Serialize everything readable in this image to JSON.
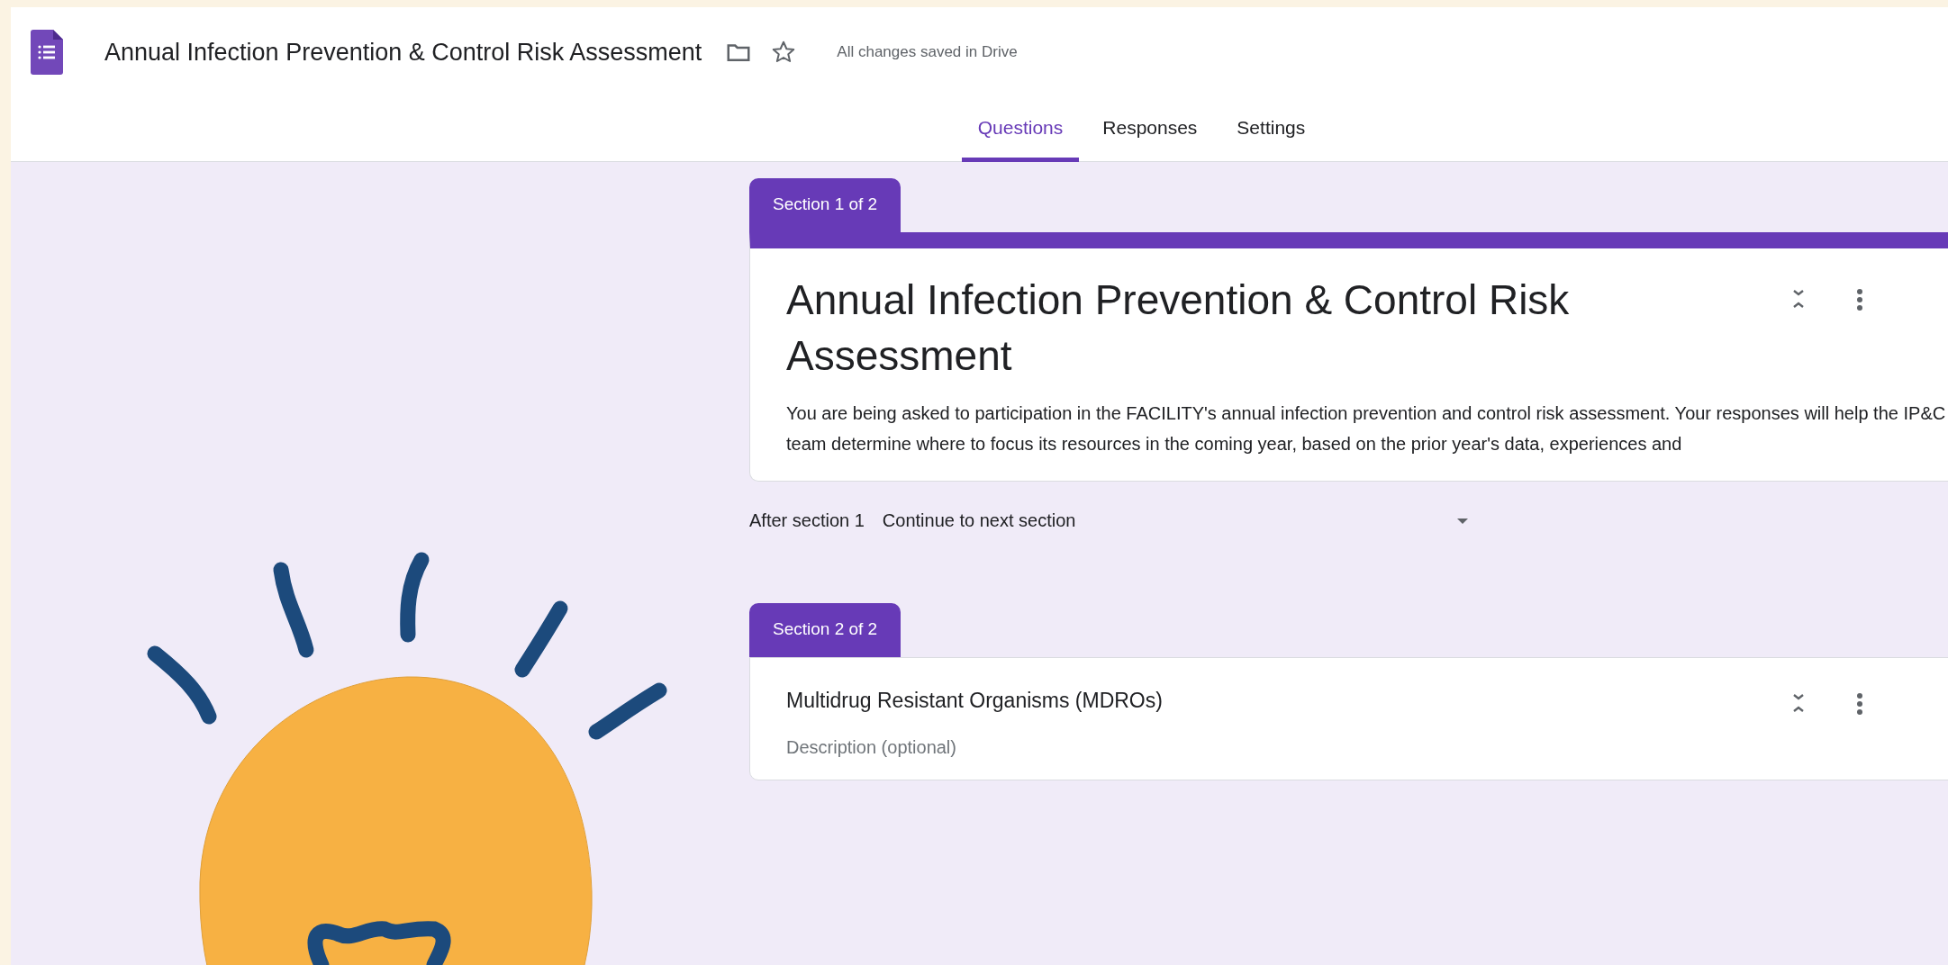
{
  "header": {
    "title": "Annual Infection Prevention & Control Risk Assessment",
    "status": "All changes saved in Drive",
    "starred": false
  },
  "tabs": [
    {
      "label": "Questions",
      "selected": true
    },
    {
      "label": "Responses",
      "selected": false
    },
    {
      "label": "Settings",
      "selected": false
    }
  ],
  "sections": [
    {
      "kind": "header",
      "tab_label": "Section 1 of 2",
      "title": "Annual Infection Prevention & Control Risk Assessment",
      "description": "You are being asked to participation in the FACILITY's annual infection prevention and control risk assessment. Your responses will help the IP&C team determine where to focus its resources in the coming year, based on the prior year's data, experiences and",
      "after": {
        "label": "After section 1",
        "value": "Continue to next section"
      }
    },
    {
      "kind": "section",
      "tab_label": "Section 2 of 2",
      "title": "Multidrug Resistant Organisms (MDROs)",
      "placeholder": "Description (optional)"
    }
  ]
}
